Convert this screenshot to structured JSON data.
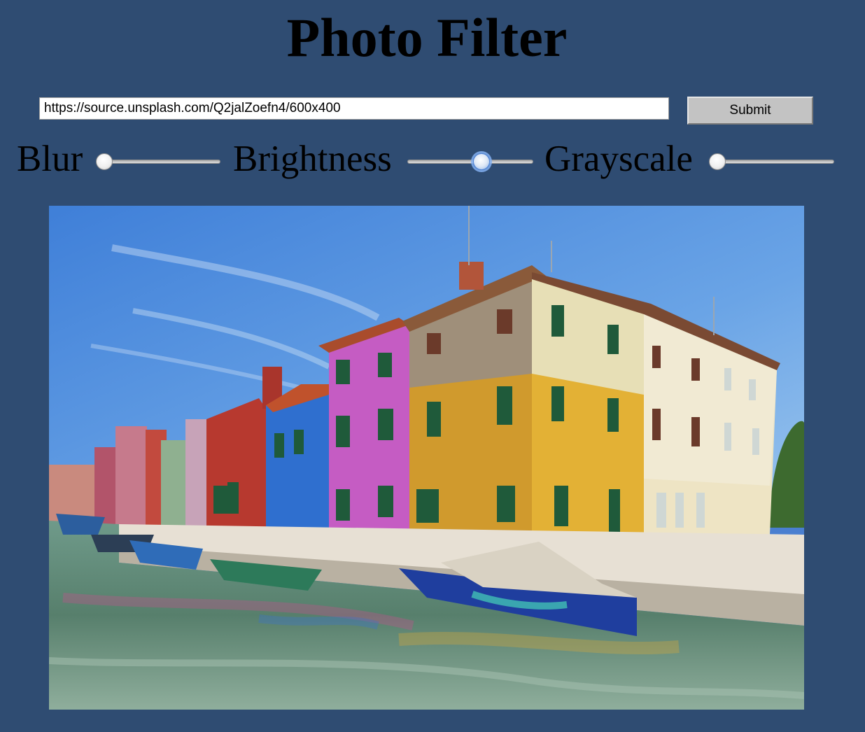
{
  "page": {
    "title": "Photo Filter",
    "background_color": "#2f4c72"
  },
  "url_form": {
    "url_value": "https://source.unsplash.com/Q2jalZoefn4/600x400",
    "submit_label": "Submit"
  },
  "filters": {
    "blur": {
      "label": "Blur",
      "value": 0,
      "min": 0,
      "max": 100
    },
    "brightness": {
      "label": "Brightness",
      "value": 60,
      "min": 0,
      "max": 100,
      "focused": true
    },
    "grayscale": {
      "label": "Grayscale",
      "value": 0,
      "min": 0,
      "max": 100
    }
  },
  "photo": {
    "icon": "photo-image"
  }
}
